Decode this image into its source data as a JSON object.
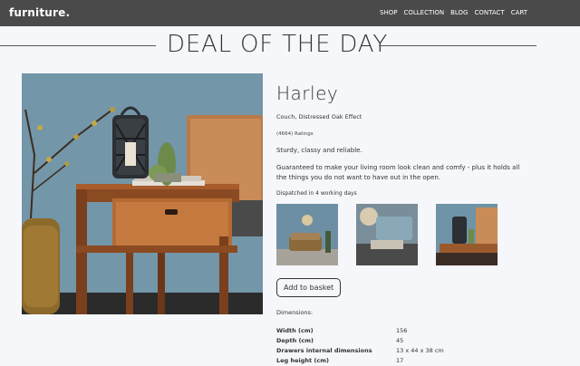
{
  "header": {
    "logo": "furniture.",
    "nav": [
      "SHOP",
      "COLLECTION",
      "BLOG",
      "CONTACT",
      "CART"
    ]
  },
  "headline": "DEAL OF THE DAY",
  "product": {
    "name": "Harley",
    "subtitle": "Couch, Distressed Oak Effect",
    "ratings": "(4664) Ratings",
    "tagline": "Sturdy, classy and reliable.",
    "description": "Guaranteed to make your living room look clean and comfy - plus it holds all the things you do not want to have out in the open.",
    "dispatch": "Dispatched in 4 working days",
    "add_button": "Add to basket",
    "dimensions_label": "Dimensions:",
    "dimensions": [
      {
        "label": "Width (cm)",
        "value": "156"
      },
      {
        "label": "Depth (cm)",
        "value": "45"
      },
      {
        "label": "Drawers internal dimensions",
        "value": "13 x 44 x 38 cm"
      },
      {
        "label": "Leg height (cm)",
        "value": "17"
      }
    ]
  },
  "colors": {
    "topbar": "#4a4a4a",
    "background": "#f5f7fa",
    "wall_blue": "#6f93a7",
    "wood": "#9b5a2e"
  }
}
